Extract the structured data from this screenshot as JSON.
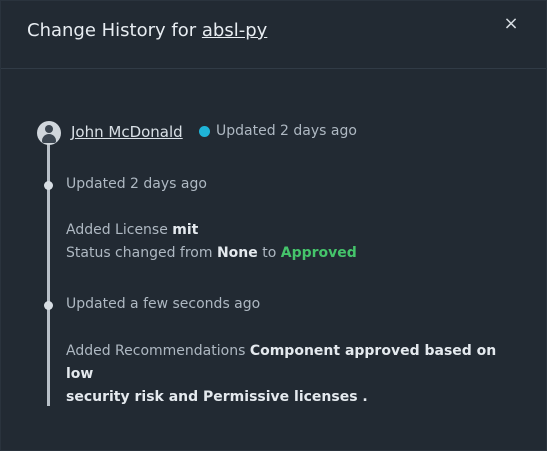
{
  "modal": {
    "title_prefix": "Change History for",
    "package_name": "absl-py",
    "close_label": "×"
  },
  "author": {
    "name": "John McDonald",
    "updated": "Updated 2 days ago",
    "status_color": "#1fb4d8"
  },
  "entries": [
    {
      "time": "Updated 2 days ago",
      "license_prefix": "Added License",
      "license_value": "mit",
      "status_prefix": "Status changed from",
      "status_from": "None",
      "status_to_word": "to",
      "status_to": "Approved"
    },
    {
      "time": "Updated a few seconds ago",
      "recommendation_prefix": "Added Recommendations",
      "recommendation_line1": "Component approved based on low",
      "recommendation_line2": "security risk and Permissive licenses ."
    }
  ],
  "colors": {
    "background": "#222a33",
    "approved": "#45c46b",
    "timeline": "#b8c0c8"
  }
}
